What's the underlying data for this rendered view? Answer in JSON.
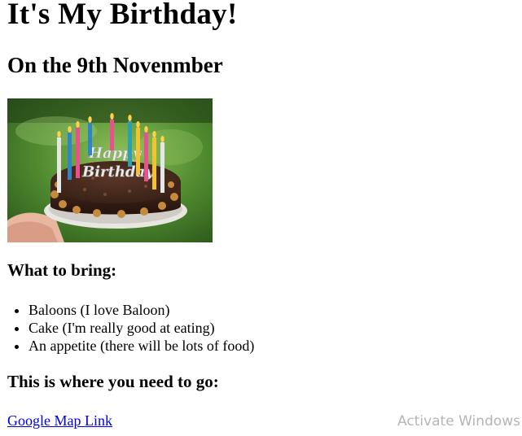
{
  "heading": {
    "title": "It's My Birthday!",
    "subtitle": "On the 9th Novenmber"
  },
  "image": {
    "icon": "birthday-cake-photo",
    "colors": {
      "background": "#4f8a2f",
      "cake": "#3a2218",
      "plate": "#e8e6e0",
      "candles": [
        "#e6e6e6",
        "#2e86c9",
        "#e8508e",
        "#f2c230",
        "#2e9fb0"
      ]
    }
  },
  "bring": {
    "heading": "What to bring:",
    "items": [
      "Baloons (I love Baloon)",
      "Cake (I'm really good at eating)",
      "An appetite (there will be lots of food)"
    ]
  },
  "location": {
    "heading": "This is where you need to go:",
    "link_text": "Google Map Link",
    "link_color": "#0000ee"
  },
  "overlay": {
    "watermark": "Activate Windows"
  }
}
